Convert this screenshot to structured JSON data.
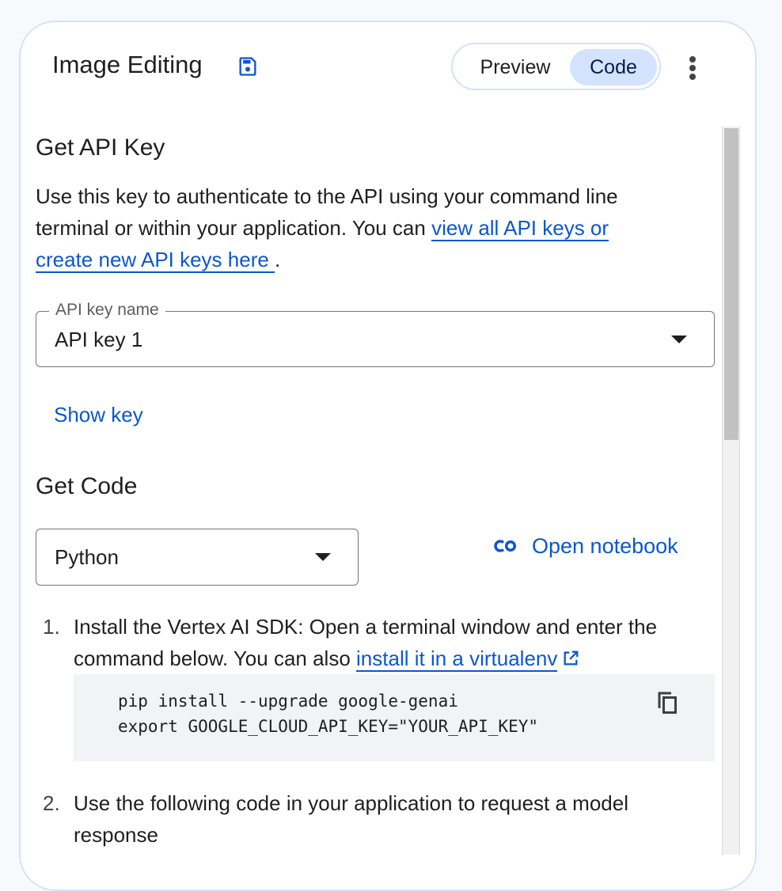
{
  "header": {
    "title": "Image Editing",
    "save_icon": "save-icon",
    "tabs": [
      {
        "label": "Preview",
        "selected": false
      },
      {
        "label": "Code",
        "selected": true
      }
    ],
    "more_icon": "more-vert-icon"
  },
  "api_key": {
    "heading": "Get API Key",
    "text_before": "Use this key to authenticate to the API using your command line terminal or within your application. You can ",
    "link_line1": "view all API keys or",
    "link_line2": "create new API keys here ",
    "text_after": ".",
    "field_label": "API key name",
    "field_value": "API key 1",
    "show_key": "Show key"
  },
  "get_code": {
    "heading": "Get Code",
    "language": "Python",
    "open_notebook": "Open notebook",
    "notebook_icon": "colab-icon"
  },
  "steps": [
    {
      "number": "1.",
      "text": "Install the Vertex AI SDK: Open a terminal window and enter the command below. You can also ",
      "link": "install it in a virtualenv",
      "code_line1": "pip install --upgrade google-genai",
      "code_line2": "export GOOGLE_CLOUD_API_KEY=\"YOUR_API_KEY\"",
      "copy_icon": "copy-icon"
    },
    {
      "number": "2.",
      "text": "Use the following code in your application to request a model response"
    }
  ],
  "colors": {
    "accent": "#0b57d0",
    "toggle_selected": "#d3e3fd",
    "code_bg": "#f1f3f4"
  }
}
